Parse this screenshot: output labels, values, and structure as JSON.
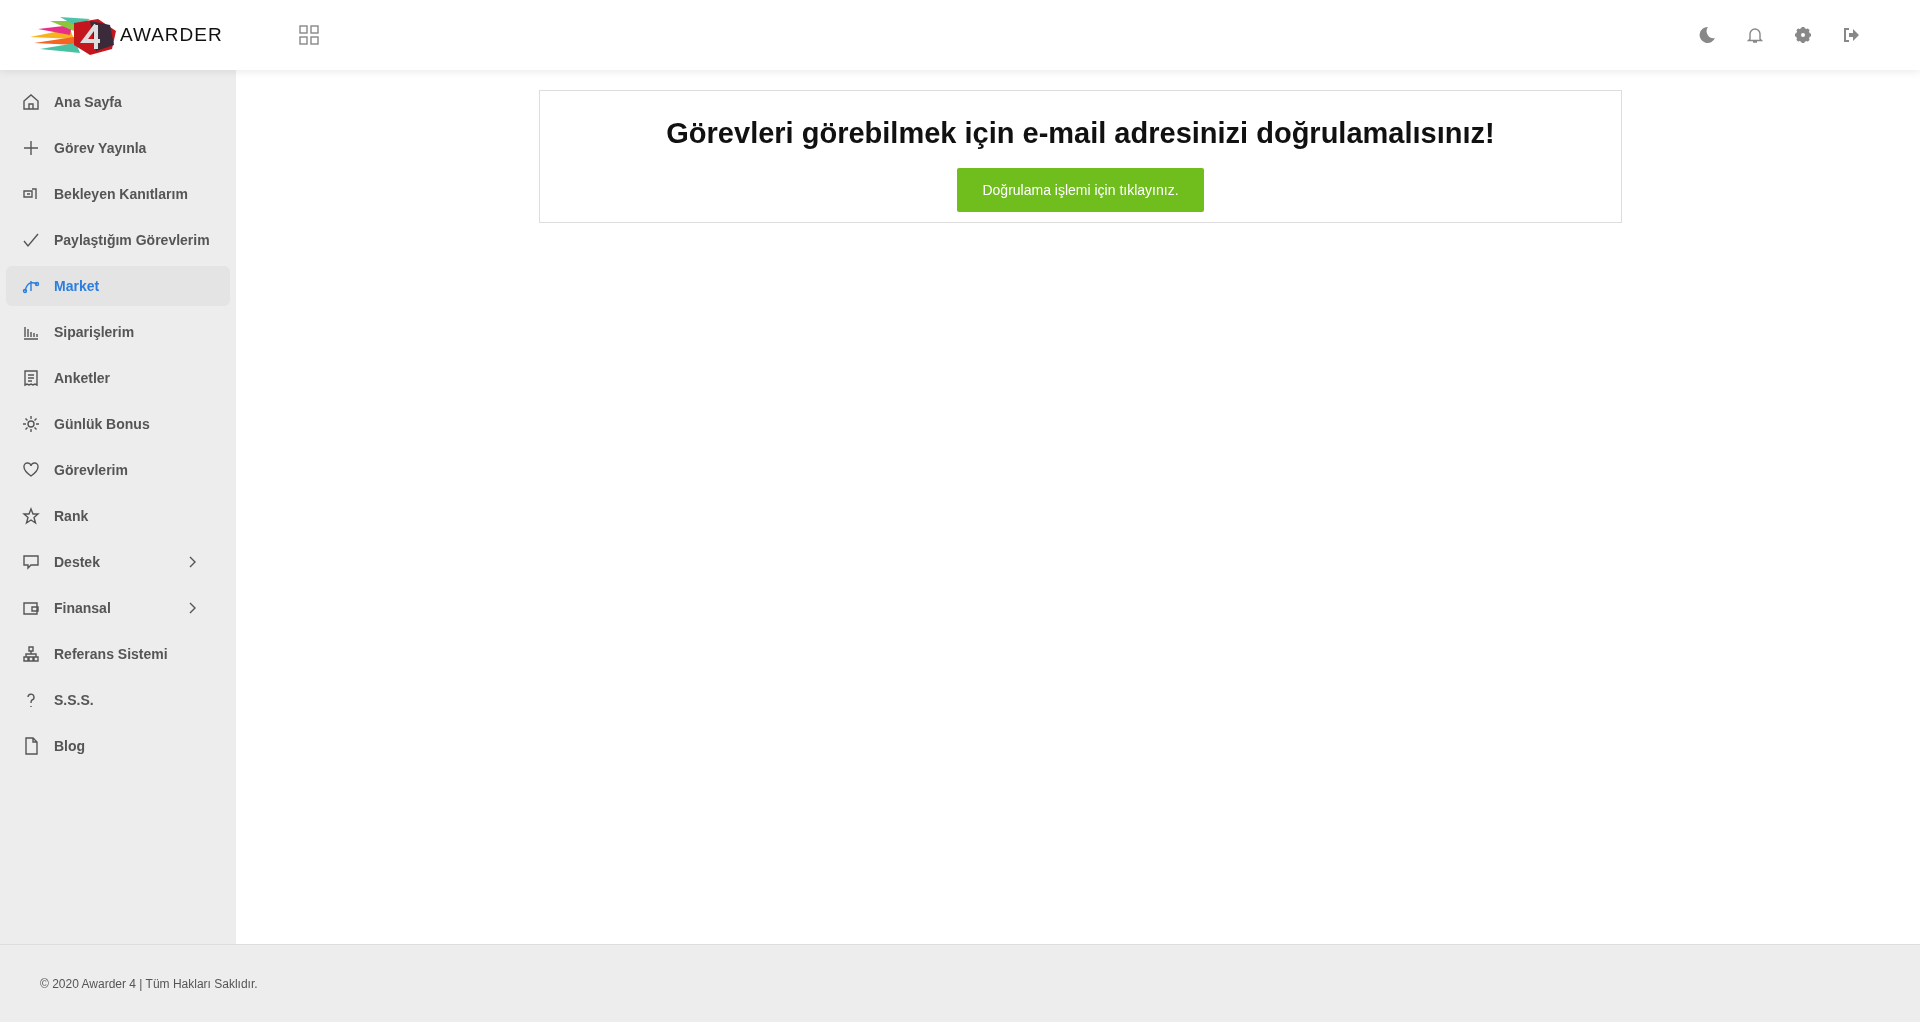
{
  "header": {
    "logo_text": "AWARDER"
  },
  "sidebar": {
    "items": [
      {
        "label": "Ana Sayfa",
        "selected": false,
        "has_submenu": false
      },
      {
        "label": "Görev Yayınla",
        "selected": false,
        "has_submenu": false
      },
      {
        "label": "Bekleyen Kanıtlarım",
        "selected": false,
        "has_submenu": false
      },
      {
        "label": "Paylaştığım Görevlerim",
        "selected": false,
        "has_submenu": false
      },
      {
        "label": "Market",
        "selected": true,
        "has_submenu": false
      },
      {
        "label": "Siparişlerim",
        "selected": false,
        "has_submenu": false
      },
      {
        "label": "Anketler",
        "selected": false,
        "has_submenu": false
      },
      {
        "label": "Günlük Bonus",
        "selected": false,
        "has_submenu": false
      },
      {
        "label": "Görevlerim",
        "selected": false,
        "has_submenu": false
      },
      {
        "label": "Rank",
        "selected": false,
        "has_submenu": false
      },
      {
        "label": "Destek",
        "selected": false,
        "has_submenu": true
      },
      {
        "label": "Finansal",
        "selected": false,
        "has_submenu": true
      },
      {
        "label": "Referans Sistemi",
        "selected": false,
        "has_submenu": false
      },
      {
        "label": "S.S.S.",
        "selected": false,
        "has_submenu": false
      },
      {
        "label": "Blog",
        "selected": false,
        "has_submenu": false
      }
    ]
  },
  "notice": {
    "title": "Görevleri görebilmek için e-mail adresinizi doğrulamalısınız!",
    "button": "Doğrulama işlemi için tıklayınız."
  },
  "footer": {
    "text": "© 2020 Awarder 4 | Tüm Hakları Saklıdır."
  }
}
